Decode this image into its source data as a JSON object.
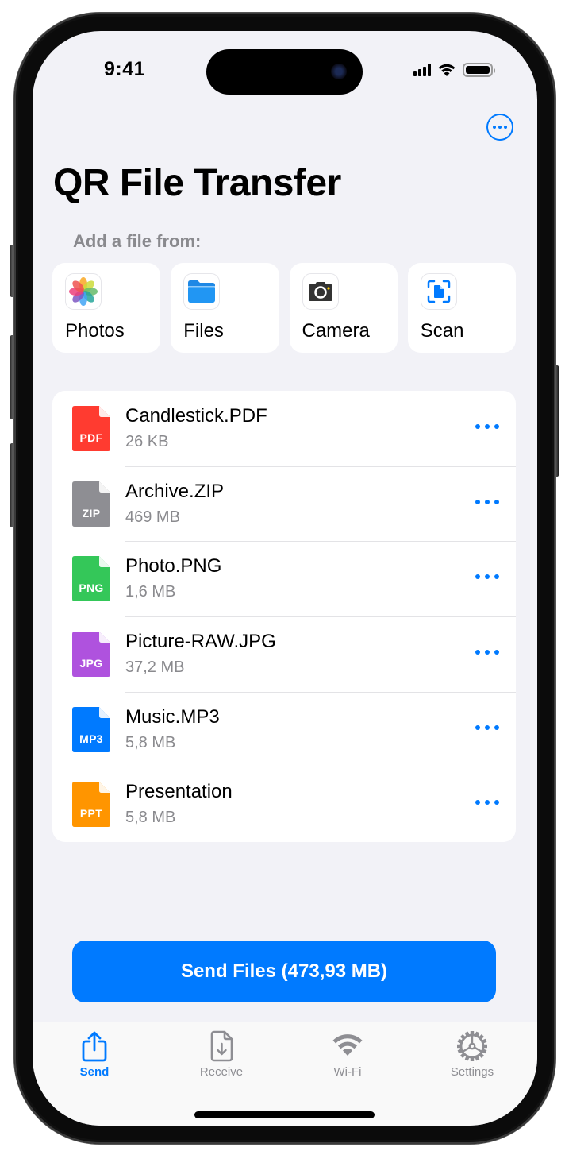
{
  "status_bar": {
    "time": "9:41"
  },
  "header": {
    "title": "QR File Transfer",
    "more_button": "more-options"
  },
  "add_section": {
    "label": "Add a file from:",
    "sources": [
      {
        "label": "Photos",
        "icon": "photos-icon"
      },
      {
        "label": "Files",
        "icon": "files-folder-icon"
      },
      {
        "label": "Camera",
        "icon": "camera-icon"
      },
      {
        "label": "Scan",
        "icon": "document-scan-icon"
      }
    ]
  },
  "files": [
    {
      "name": "Candlestick.PDF",
      "size": "26 KB",
      "type": "PDF",
      "color": "#ff3b30"
    },
    {
      "name": "Archive.ZIP",
      "size": "469 MB",
      "type": "ZIP",
      "color": "#8e8e93"
    },
    {
      "name": "Photo.PNG",
      "size": "1,6 MB",
      "type": "PNG",
      "color": "#34c759"
    },
    {
      "name": "Picture-RAW.JPG",
      "size": "37,2 MB",
      "type": "JPG",
      "color": "#af52de"
    },
    {
      "name": "Music.MP3",
      "size": "5,8 MB",
      "type": "MP3",
      "color": "#007aff"
    },
    {
      "name": "Presentation",
      "size": "5,8 MB",
      "type": "PPT",
      "color": "#ff9500"
    }
  ],
  "send_button": {
    "label": "Send Files (473,93 MB)"
  },
  "tabbar": {
    "active": "Send",
    "tabs": [
      {
        "label": "Send",
        "icon": "share-upload-icon"
      },
      {
        "label": "Receive",
        "icon": "document-download-icon"
      },
      {
        "label": "Wi-Fi",
        "icon": "wifi-icon"
      },
      {
        "label": "Settings",
        "icon": "gear-icon"
      }
    ]
  },
  "colors": {
    "accent": "#007aff",
    "background": "#f2f2f7",
    "secondary_text": "#8a8a8e"
  }
}
